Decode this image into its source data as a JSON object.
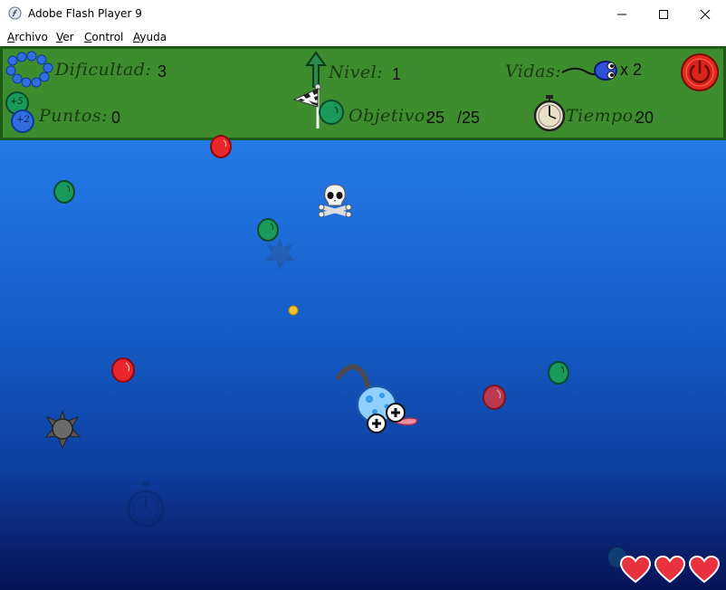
{
  "window": {
    "title": "Adobe Flash Player 9",
    "icons": {
      "app": "flash-player-icon",
      "minimize": "minimize-icon",
      "maximize": "maximize-icon",
      "close": "close-icon"
    }
  },
  "menu": {
    "items": [
      "Archivo",
      "Ver",
      "Control",
      "Ayuda"
    ]
  },
  "hud": {
    "difficulty_label": "Dificultad:",
    "difficulty_value": "3",
    "points_label": "Puntos:",
    "points_value": "0",
    "level_label": "Nivel:",
    "level_value": "1",
    "objective_label": "Objetivo:",
    "objective_value": "25",
    "objective_total": "/25",
    "lives_label": "Vidas:",
    "lives_value": "x 2",
    "time_label": "Tiempo:",
    "time_value": "20",
    "badge_plus5": "+5",
    "badge_plus2": "+2",
    "colors": {
      "panel": "#3d8c2e",
      "border": "#1c5a16",
      "power": "#e02a1e"
    }
  },
  "scene": {
    "entities": [
      "red-ball",
      "green-ball",
      "skull-crossbones",
      "spiked-mine",
      "gold-food-pellet",
      "blue-sperm-player",
      "stopwatch-bonus",
      "heart-life"
    ],
    "hearts_count": 3,
    "colors": {
      "water_top": "#2f88f2",
      "water_bottom": "#061258",
      "red_ball": "#e8262c",
      "green_ball": "#1a9a5a",
      "heart": "#e8323e"
    }
  }
}
